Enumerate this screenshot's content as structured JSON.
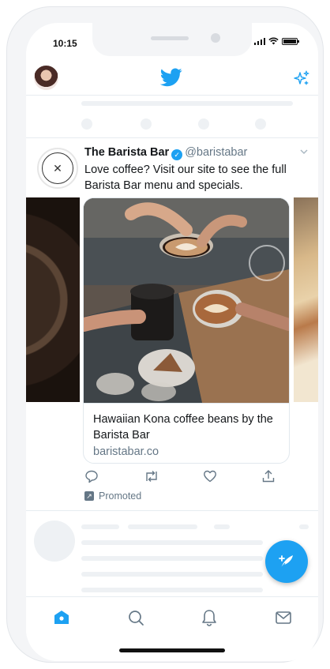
{
  "status_bar": {
    "time": "10:15"
  },
  "header": {
    "avatar": "user-avatar",
    "logo": "twitter-bird-icon",
    "right_icon": "sparkle-icon"
  },
  "tweet": {
    "name": "The Barista Bar",
    "verified_icon": "verified-badge-icon",
    "handle": "@baristabar",
    "text": "Love coffee? Visit our site to see the full Barista Bar menu and specials.",
    "card": {
      "title": "Hawaiian Kona coffee beans by the Barista Bar",
      "url": "baristabar.co"
    },
    "actions": [
      "reply-icon",
      "retweet-icon",
      "like-icon",
      "share-icon"
    ],
    "promoted_label": "Promoted"
  },
  "tabbar": {
    "tabs": [
      "home-icon",
      "search-icon",
      "notifications-icon",
      "messages-icon"
    ],
    "active": "home-icon"
  },
  "colors": {
    "accent": "#1da1f2",
    "text": "#14171a",
    "secondary_text": "#657786",
    "divider": "#e6ecf0"
  }
}
